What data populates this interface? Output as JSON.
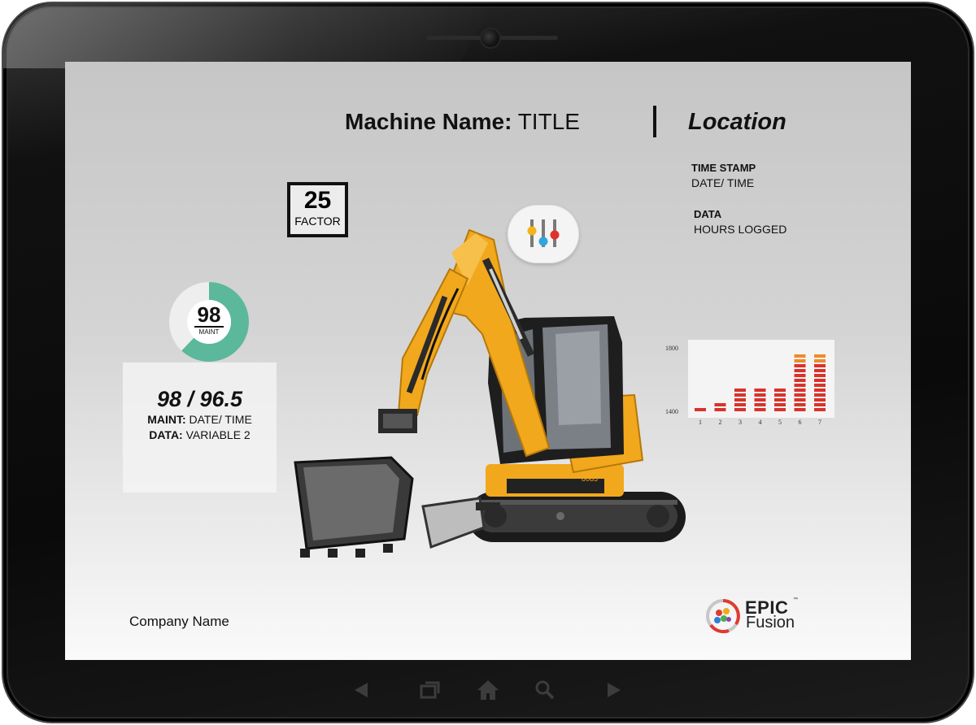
{
  "header": {
    "machine_label": "Machine Name:",
    "machine_value": "TITLE",
    "location": "Location"
  },
  "time_stamp": {
    "label": "TIME STAMP",
    "value": "DATE/ TIME"
  },
  "data_block": {
    "label": "DATA",
    "value": "HOURS LOGGED"
  },
  "factor": {
    "value": "25",
    "label": "FACTOR"
  },
  "maint_gauge": {
    "value": "98",
    "label": "MAINT",
    "fill_percent": 62
  },
  "stats": {
    "headline": "98 / 96.5",
    "maint_label": "MAINT:",
    "maint_value": "DATE/ TIME",
    "data_label": "DATA:",
    "data_value": "VARIABLE 2"
  },
  "chart_data": {
    "type": "bar",
    "categories": [
      "1",
      "2",
      "3",
      "4",
      "5",
      "6",
      "7"
    ],
    "values": [
      1440,
      1470,
      1570,
      1550,
      1570,
      1780,
      1780
    ],
    "y_tick_labels": [
      "1400",
      "1800"
    ],
    "ylim": [
      1400,
      1800
    ]
  },
  "footer": {
    "company": "Company Name"
  },
  "logo": {
    "line1": "EPIC",
    "tm": "™",
    "line2": "Fusion"
  },
  "machine_badge": "8085",
  "colors": {
    "gauge_fill": "#5bb89a",
    "bar_red": "#d9322b",
    "bar_orange": "#ef8a2a",
    "excavator_yellow": "#f2a81c"
  },
  "icons": {
    "settings": "sliders-icon",
    "nav": [
      "back-arrow-icon",
      "recent-apps-icon",
      "home-icon",
      "search-icon",
      "forward-arrow-icon"
    ]
  }
}
